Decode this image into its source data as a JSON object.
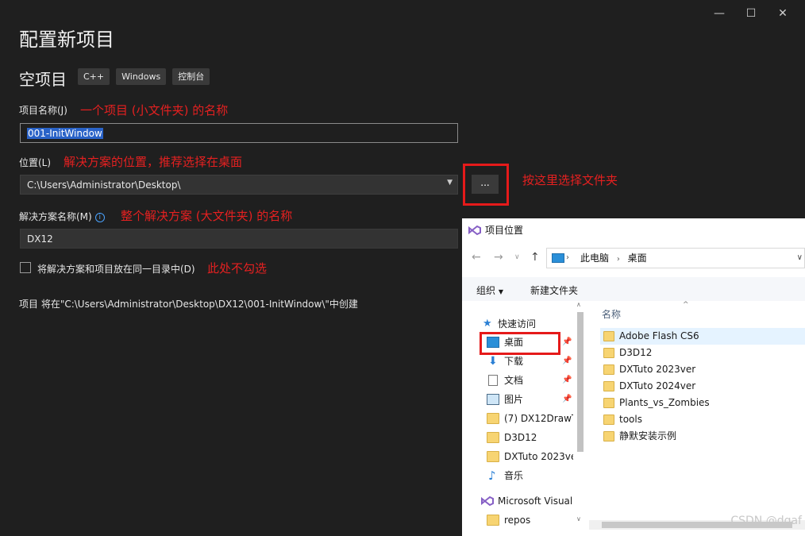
{
  "window": {
    "minimize": "—",
    "maximize": "☐",
    "close": "✕"
  },
  "page_title": "配置新项目",
  "template": {
    "name": "空项目",
    "tags": [
      "C++",
      "Windows",
      "控制台"
    ]
  },
  "project_name": {
    "label": "项目名称(J)",
    "value": "001-InitWindow",
    "note": "一个项目 (小文件夹) 的名称"
  },
  "location": {
    "label": "位置(L)",
    "value": "C:\\Users\\Administrator\\Desktop\\",
    "note": "解决方案的位置，推荐选择在桌面",
    "browse_label": "...",
    "browse_note": "按这里选择文件夹"
  },
  "solution_name": {
    "label": "解决方案名称(M)",
    "value": "DX12",
    "note": "整个解决方案 (大文件夹) 的名称"
  },
  "same_dir": {
    "label": "将解决方案和项目放在同一目录中(D)",
    "checked": false,
    "note": "此处不勾选"
  },
  "summary": "项目 将在\"C:\\Users\\Administrator\\Desktop\\DX12\\001-InitWindow\\\"中创建",
  "dialog": {
    "title": "项目位置",
    "breadcrumb": [
      "此电脑",
      "桌面"
    ],
    "toolbar": {
      "organize": "组织",
      "new_folder": "新建文件夹"
    },
    "column_name": "名称",
    "tree": [
      {
        "label": "快速访问",
        "icon": "star-icon",
        "pinned": false
      },
      {
        "label": "桌面",
        "icon": "desktop-icon",
        "pinned": true
      },
      {
        "label": "下载",
        "icon": "download-icon",
        "pinned": true
      },
      {
        "label": "文档",
        "icon": "document-icon",
        "pinned": true
      },
      {
        "label": "图片",
        "icon": "picture-icon",
        "pinned": true
      },
      {
        "label": "(7) DX12DrawT",
        "icon": "folder-icon",
        "pinned": false
      },
      {
        "label": "D3D12",
        "icon": "folder-icon",
        "pinned": false
      },
      {
        "label": "DXTuto 2023ve",
        "icon": "folder-icon",
        "pinned": false
      },
      {
        "label": "音乐",
        "icon": "music-icon",
        "pinned": false
      },
      {
        "label": "Microsoft Visual",
        "icon": "vs-icon",
        "pinned": false
      },
      {
        "label": "repos",
        "icon": "folder-icon",
        "pinned": false
      }
    ],
    "files": [
      "Adobe Flash CS6",
      "D3D12",
      "DXTuto 2023ver",
      "DXTuto 2024ver",
      "Plants_vs_Zombies",
      "tools",
      "静默安装示例"
    ]
  },
  "watermark": "CSDN @dgaf",
  "colors": {
    "accent_red": "#e52020",
    "selection_blue": "#2a63c8",
    "link_blue": "#4aa3ff"
  }
}
